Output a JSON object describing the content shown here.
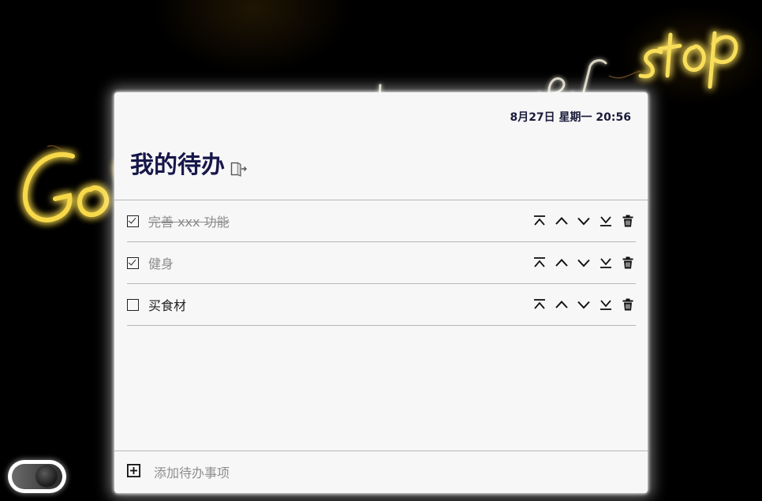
{
  "background": {
    "neon_text": "Go on and never stop"
  },
  "header": {
    "datetime": "8月27日 星期一 20:56",
    "title": "我的待办"
  },
  "icons": {
    "logout": "logout-icon",
    "check": "checkbox-checked-icon",
    "uncheck": "checkbox-empty-icon",
    "move_top": "move-to-top-icon",
    "move_up": "chevron-up-icon",
    "move_down": "chevron-down-icon",
    "move_bottom": "move-to-bottom-icon",
    "delete": "trash-icon",
    "add": "plus-square-icon"
  },
  "todos": [
    {
      "text": "完善 xxx 功能",
      "done": true,
      "struck": true
    },
    {
      "text": "健身",
      "done": true,
      "struck": false
    },
    {
      "text": "买食材",
      "done": false,
      "struck": false
    }
  ],
  "add": {
    "placeholder": "添加待办事项",
    "value": ""
  },
  "theme_toggle": {
    "state": "dark"
  },
  "colors": {
    "title": "#17174a",
    "card_bg": "#f7f7f8",
    "neon_yellow": "#f5d84a",
    "neon_white": "#fffbe6"
  }
}
